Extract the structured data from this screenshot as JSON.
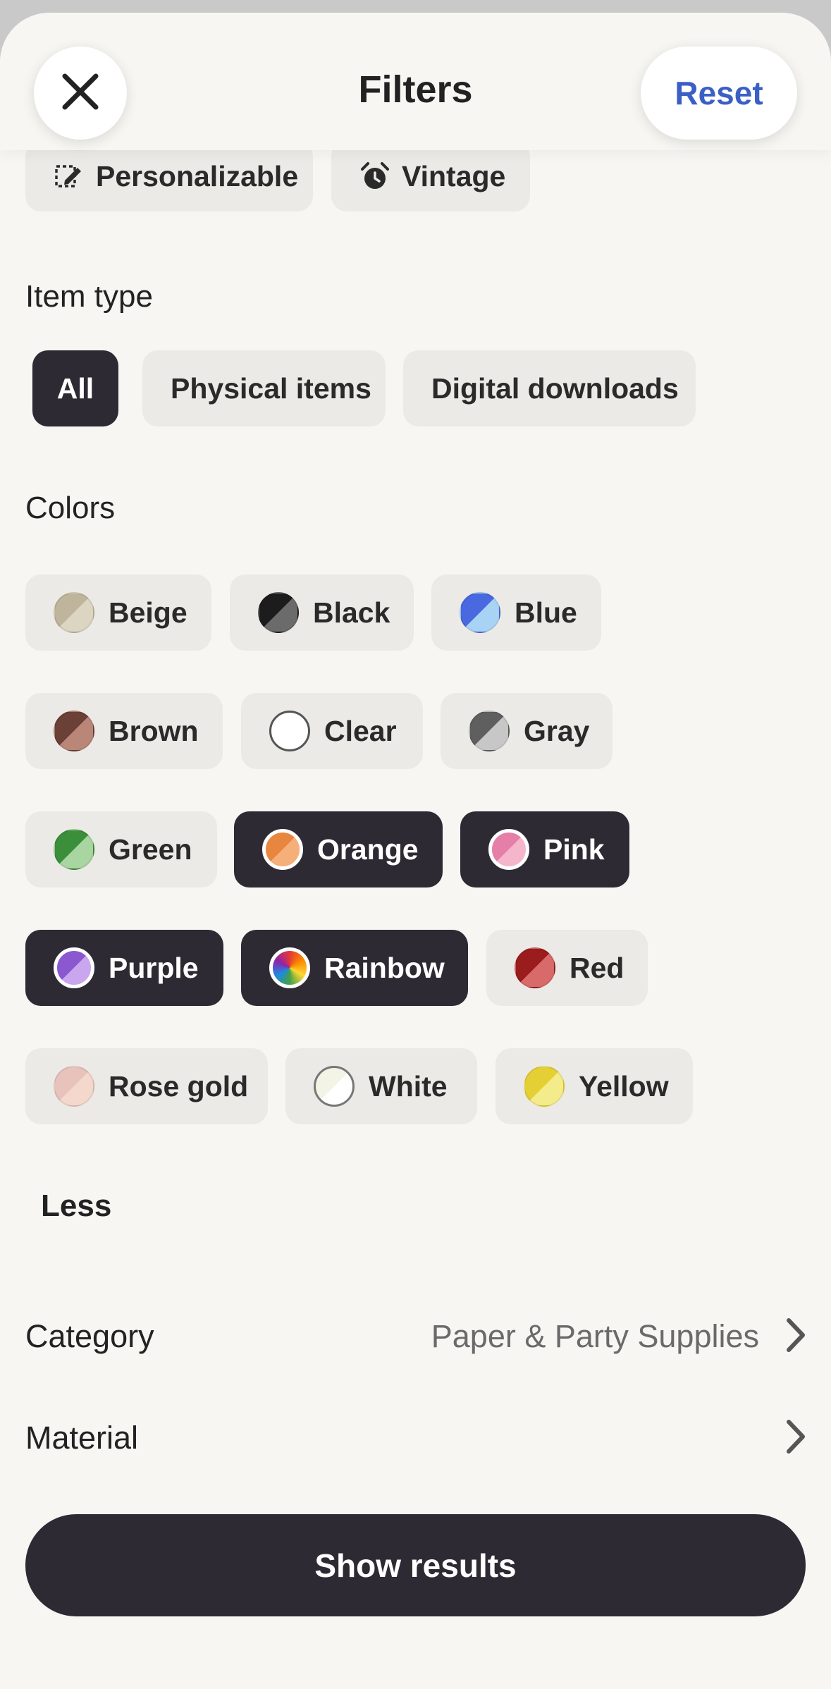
{
  "header": {
    "title": "Filters",
    "reset_label": "Reset",
    "close_icon": "close-icon"
  },
  "special_offers": {
    "items": [
      {
        "label": "Personalizable",
        "icon": "personalize-icon"
      },
      {
        "label": "Vintage",
        "icon": "alarm-clock-icon"
      }
    ]
  },
  "item_type": {
    "label": "Item type",
    "options": [
      {
        "label": "All",
        "selected": true
      },
      {
        "label": "Physical items",
        "selected": false
      },
      {
        "label": "Digital downloads",
        "selected": false
      }
    ]
  },
  "colors": {
    "label": "Colors",
    "options": [
      {
        "label": "Beige",
        "selected": false,
        "c1": "#bfb59c",
        "c2": "#dcd5c2"
      },
      {
        "label": "Black",
        "selected": false,
        "c1": "#1c1c1c",
        "c2": "#6b6b6b"
      },
      {
        "label": "Blue",
        "selected": false,
        "c1": "#4a69e0",
        "c2": "#a9d3f5"
      },
      {
        "label": "Brown",
        "selected": false,
        "c1": "#6b4037",
        "c2": "#b98678"
      },
      {
        "label": "Clear",
        "selected": false,
        "c1": "#ffffff",
        "c2": "#ffffff"
      },
      {
        "label": "Gray",
        "selected": false,
        "c1": "#5f5f5f",
        "c2": "#c7c7c7"
      },
      {
        "label": "Green",
        "selected": false,
        "c1": "#3b8f3a",
        "c2": "#a9d5a0"
      },
      {
        "label": "Orange",
        "selected": true,
        "c1": "#e8853f",
        "c2": "#f5b07a"
      },
      {
        "label": "Pink",
        "selected": true,
        "c1": "#e57fa8",
        "c2": "#f5b6cc"
      },
      {
        "label": "Purple",
        "selected": true,
        "c1": "#8b58d0",
        "c2": "#c9a6ee"
      },
      {
        "label": "Rainbow",
        "selected": true,
        "c1": "rainbow",
        "c2": "rainbow"
      },
      {
        "label": "Red",
        "selected": false,
        "c1": "#9b1c1c",
        "c2": "#d86a6a"
      },
      {
        "label": "Rose gold",
        "selected": false,
        "c1": "#e8c3bc",
        "c2": "#f5d8cc"
      },
      {
        "label": "White",
        "selected": false,
        "c1": "#f3f3e6",
        "c2": "#ffffff"
      },
      {
        "label": "Yellow",
        "selected": false,
        "c1": "#e4d034",
        "c2": "#f4ec8a"
      }
    ],
    "less_label": "Less"
  },
  "category": {
    "label": "Category",
    "value": "Paper & Party Supplies"
  },
  "material": {
    "label": "Material",
    "value": ""
  },
  "footer": {
    "show_results_label": "Show results"
  }
}
